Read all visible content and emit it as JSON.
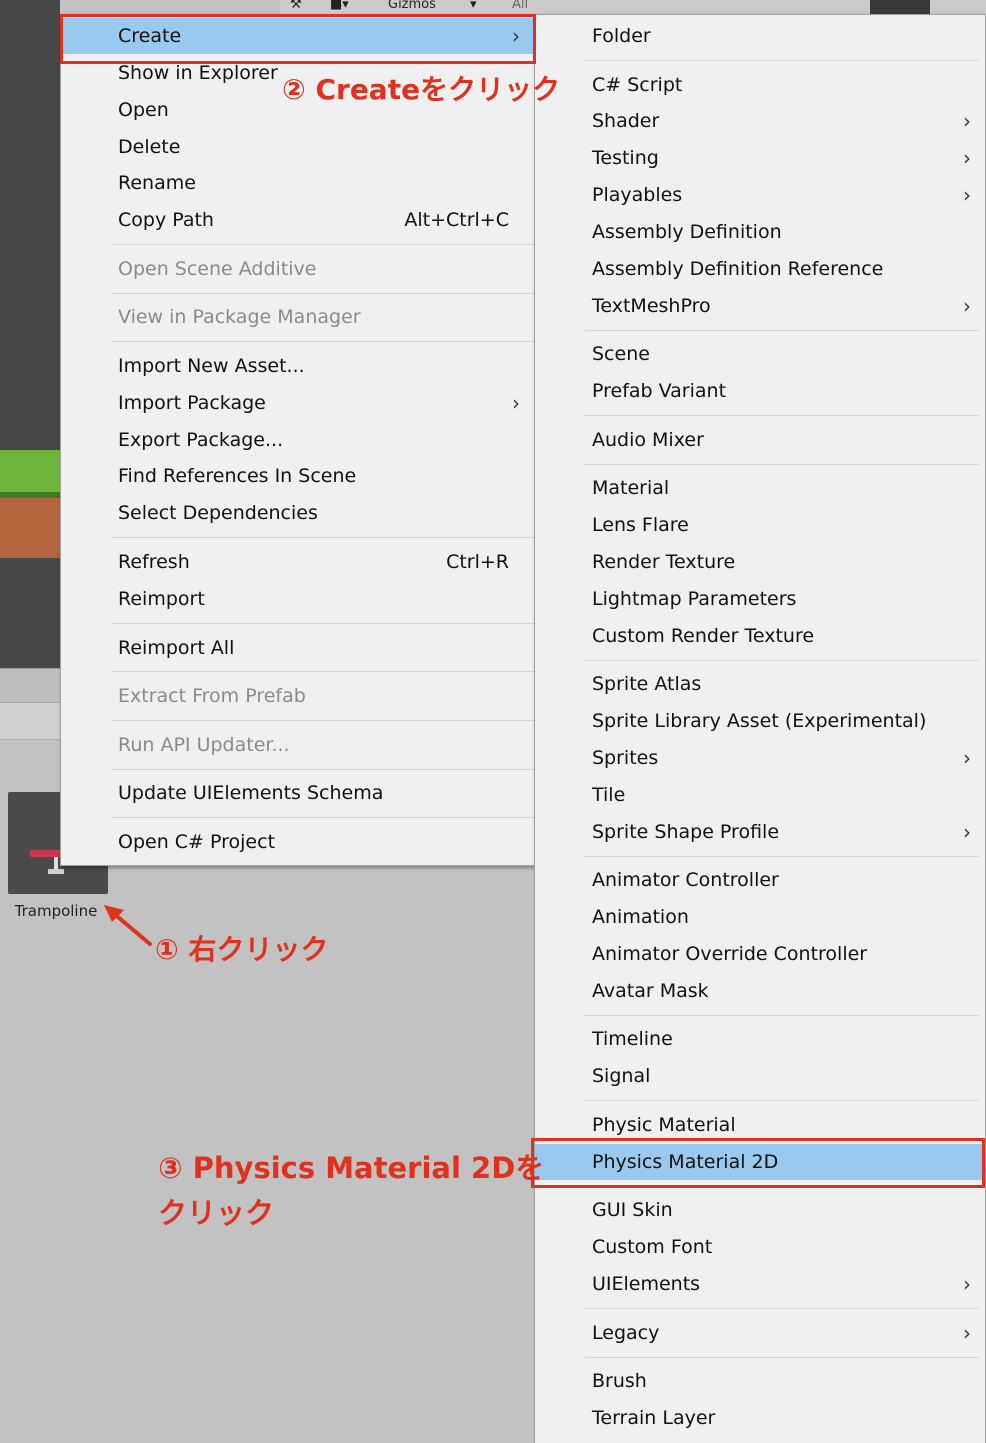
{
  "toolbar": {
    "gizmos_label": "Gizmos",
    "search_placeholder": "All"
  },
  "asset": {
    "name": "Trampoline"
  },
  "main_menu": {
    "items": [
      {
        "label": "Create",
        "arrow": "›"
      },
      {
        "label": "Show in Explorer"
      },
      {
        "label": "Open"
      },
      {
        "label": "Delete"
      },
      {
        "label": "Rename"
      },
      {
        "label": "Copy Path",
        "shortcut": "Alt+Ctrl+C"
      },
      {
        "label": "Open Scene Additive"
      },
      {
        "label": "View in Package Manager"
      },
      {
        "label": "Import New Asset..."
      },
      {
        "label": "Import Package",
        "arrow": "›"
      },
      {
        "label": "Export Package..."
      },
      {
        "label": "Find References In Scene"
      },
      {
        "label": "Select Dependencies"
      },
      {
        "label": "Refresh",
        "shortcut": "Ctrl+R"
      },
      {
        "label": "Reimport"
      },
      {
        "label": "Reimport All"
      },
      {
        "label": "Extract From Prefab"
      },
      {
        "label": "Run API Updater..."
      },
      {
        "label": "Update UIElements Schema"
      },
      {
        "label": "Open C# Project"
      }
    ]
  },
  "create_submenu": {
    "items": [
      {
        "label": "Folder"
      },
      {
        "label": "C# Script"
      },
      {
        "label": "Shader",
        "arrow": "›"
      },
      {
        "label": "Testing",
        "arrow": "›"
      },
      {
        "label": "Playables",
        "arrow": "›"
      },
      {
        "label": "Assembly Definition"
      },
      {
        "label": "Assembly Definition Reference"
      },
      {
        "label": "TextMeshPro",
        "arrow": "›"
      },
      {
        "label": "Scene"
      },
      {
        "label": "Prefab Variant"
      },
      {
        "label": "Audio Mixer"
      },
      {
        "label": "Material"
      },
      {
        "label": "Lens Flare"
      },
      {
        "label": "Render Texture"
      },
      {
        "label": "Lightmap Parameters"
      },
      {
        "label": "Custom Render Texture"
      },
      {
        "label": "Sprite Atlas"
      },
      {
        "label": "Sprite Library Asset (Experimental)"
      },
      {
        "label": "Sprites",
        "arrow": "›"
      },
      {
        "label": "Tile"
      },
      {
        "label": "Sprite Shape Profile",
        "arrow": "›"
      },
      {
        "label": "Animator Controller"
      },
      {
        "label": "Animation"
      },
      {
        "label": "Animator Override Controller"
      },
      {
        "label": "Avatar Mask"
      },
      {
        "label": "Timeline"
      },
      {
        "label": "Signal"
      },
      {
        "label": "Physic Material"
      },
      {
        "label": "Physics Material 2D"
      },
      {
        "label": "GUI Skin"
      },
      {
        "label": "Custom Font"
      },
      {
        "label": "UIElements",
        "arrow": "›"
      },
      {
        "label": "Legacy",
        "arrow": "›"
      },
      {
        "label": "Brush"
      },
      {
        "label": "Terrain Layer"
      }
    ]
  },
  "annotations": {
    "step1": "① 右クリック",
    "step2": "② Createをクリック",
    "step3_line1": "③ Physics Material 2Dを",
    "step3_line2": "クリック",
    "color": "#e0301e"
  },
  "colors": {
    "highlight": "#99c9ef",
    "menu_bg": "#f0f0f0",
    "disabled_text": "#8a8a8a"
  }
}
